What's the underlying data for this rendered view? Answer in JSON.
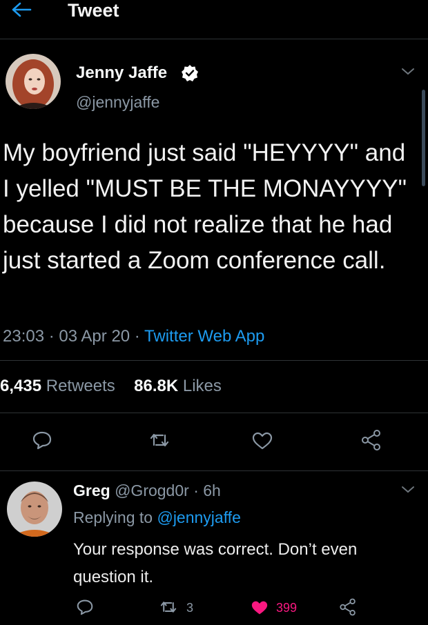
{
  "header": {
    "title": "Tweet"
  },
  "tweet": {
    "author_name": "Jenny Jaffe",
    "author_handle": "@jennyjaffe",
    "text": "My boyfriend just said \"HEYYYY\" and I yelled \"MUST BE THE MONAYYYY\" because I did not realize that he had just started a Zoom conference call.",
    "time": "23:03 · 03 Apr 20 · ",
    "source": "Twitter Web App",
    "retweets_count": "6,435",
    "retweets_label": "Retweets",
    "likes_count": "86.8K",
    "likes_label": "Likes"
  },
  "reply": {
    "author_name": "Greg",
    "author_handle": "@Grogd0r",
    "time": " · 6h",
    "replying_prefix": "Replying to ",
    "replying_handle": "@jennyjaffe",
    "text": "Your response was correct.  Don’t even question it.",
    "retweet_count": "3",
    "like_count": "399"
  },
  "colors": {
    "accent": "#1d9bf0",
    "like": "#f91880",
    "background": "#000000"
  },
  "icons": [
    "back-arrow-icon",
    "verified-badge-icon",
    "chevron-down-icon",
    "reply-icon",
    "retweet-icon",
    "like-icon",
    "share-icon"
  ]
}
